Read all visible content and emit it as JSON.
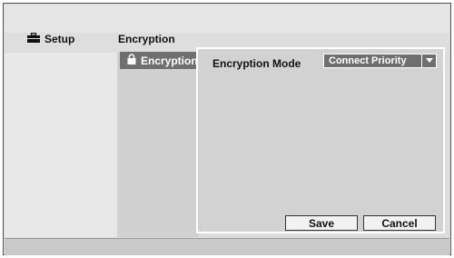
{
  "header": {
    "setup_label": "Setup",
    "section_title": "Encryption"
  },
  "nav": {
    "items": [
      {
        "label": "Encryption",
        "icon": "lock-icon",
        "selected": true
      }
    ]
  },
  "content": {
    "encryption_mode_label": "Encryption Mode",
    "encryption_mode_value": "Connect Priority"
  },
  "buttons": {
    "save_label": "Save",
    "cancel_label": "Cancel"
  },
  "icons": {
    "setup": "toolbox-icon",
    "nav_lock": "lock-icon",
    "dropdown": "chevron-down-icon"
  },
  "colors": {
    "selected_bg": "#6f6f6f",
    "panel_bg": "#d2d2d2",
    "pane_light": "#e8e8e8"
  }
}
